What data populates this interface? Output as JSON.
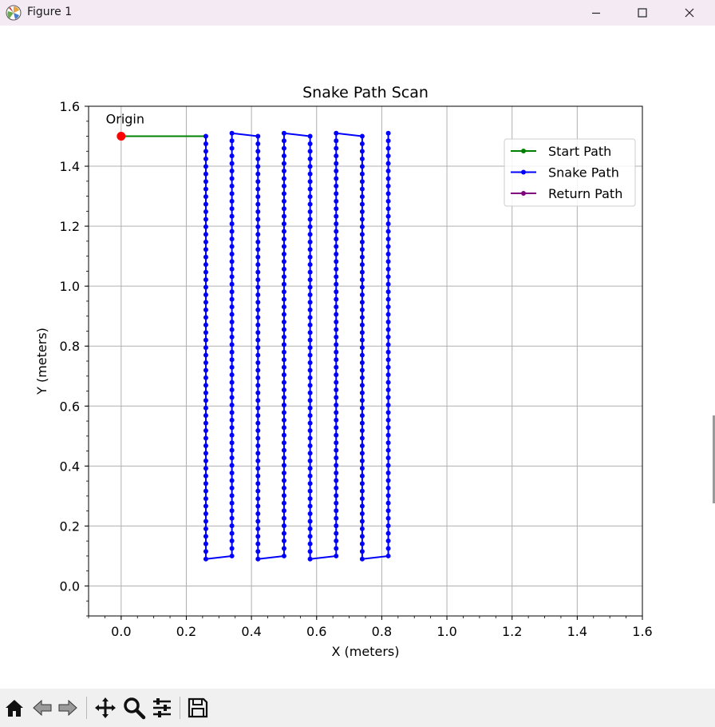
{
  "window": {
    "title": "Figure 1",
    "icon": "matplotlib-icon",
    "controls": [
      "minimize-icon",
      "maximize-icon",
      "close-icon"
    ]
  },
  "toolbar": {
    "buttons": [
      "home-icon",
      "back-icon",
      "forward-icon",
      "pan-icon",
      "zoom-icon",
      "configure-subplots-icon",
      "save-icon"
    ]
  },
  "chart_data": {
    "type": "line",
    "title": "Snake Path Scan",
    "xlabel": "X (meters)",
    "ylabel": "Y (meters)",
    "xlim": [
      -0.1,
      1.6
    ],
    "ylim": [
      -0.1,
      1.6
    ],
    "xticks": [
      "0.0",
      "0.2",
      "0.4",
      "0.6",
      "0.8",
      "1.0",
      "1.2",
      "1.4",
      "1.6"
    ],
    "yticks": [
      "0.0",
      "0.2",
      "0.4",
      "0.6",
      "0.8",
      "1.0",
      "1.2",
      "1.4",
      "1.6"
    ],
    "grid": true,
    "legend_position": "top-right",
    "series": [
      {
        "name": "Start Path",
        "color": "#008000",
        "x": [
          0.0,
          0.26
        ],
        "y": [
          1.5,
          1.5
        ]
      },
      {
        "name": "Snake Path",
        "color": "#0000ff",
        "columns": [
          {
            "x": 0.26,
            "y_from": 1.5,
            "y_to": 0.09
          },
          {
            "x": 0.34,
            "y_from": 0.1,
            "y_to": 1.51
          },
          {
            "x": 0.42,
            "y_from": 1.5,
            "y_to": 0.09
          },
          {
            "x": 0.5,
            "y_from": 0.1,
            "y_to": 1.51
          },
          {
            "x": 0.58,
            "y_from": 1.5,
            "y_to": 0.09
          },
          {
            "x": 0.66,
            "y_from": 0.1,
            "y_to": 1.51
          },
          {
            "x": 0.74,
            "y_from": 1.5,
            "y_to": 0.09
          },
          {
            "x": 0.82,
            "y_from": 0.1,
            "y_to": 1.51
          }
        ],
        "point_spacing": 0.025
      },
      {
        "name": "Return Path",
        "color": "#800080",
        "x": [],
        "y": []
      }
    ],
    "annotations": [
      {
        "text": "Origin",
        "x": 0.0,
        "y": 1.5,
        "marker_color": "#ff0000"
      }
    ]
  }
}
